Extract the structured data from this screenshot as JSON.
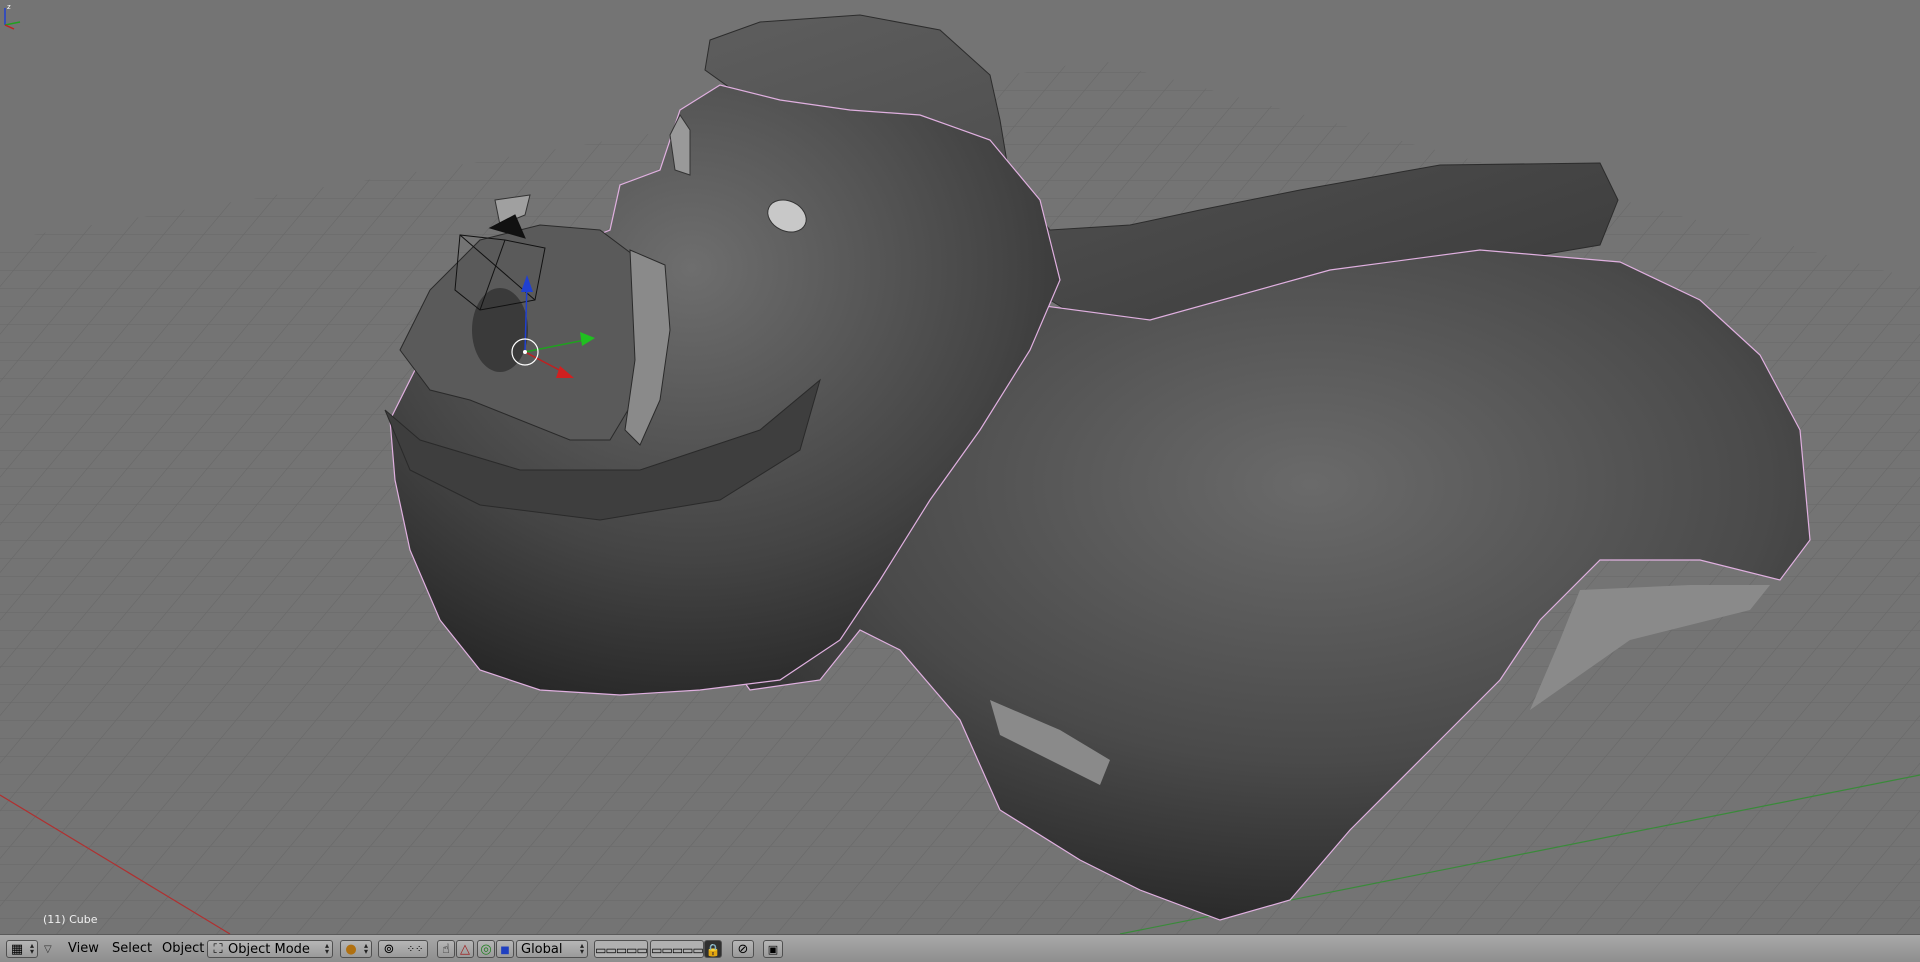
{
  "viewport": {
    "object_label": "(11) Cube",
    "axis_labels": {
      "z": "z",
      "y": "y",
      "x": "x"
    }
  },
  "header": {
    "editor_type_icon": "grid-icon",
    "menu_view": "View",
    "menu_select": "Select",
    "menu_object": "Object",
    "mode_value": "Object Mode",
    "orientation_value": "Global",
    "icons": [
      "object-mode-icon",
      "viewport-shading-icon",
      "pivot-icon",
      "manipulator-icon",
      "translate-icon",
      "rotate-icon",
      "scale-icon",
      "layers-icon",
      "lock-icon",
      "snap-icon",
      "render-icon"
    ]
  },
  "colors": {
    "viewport_bg": "#747474",
    "grid": "#6b6b6b",
    "header": "#9c9c9c",
    "axis_x": "#c02020",
    "axis_y": "#20a020",
    "axis_z": "#2040d0",
    "selection_outline": "#e8b8e8"
  }
}
